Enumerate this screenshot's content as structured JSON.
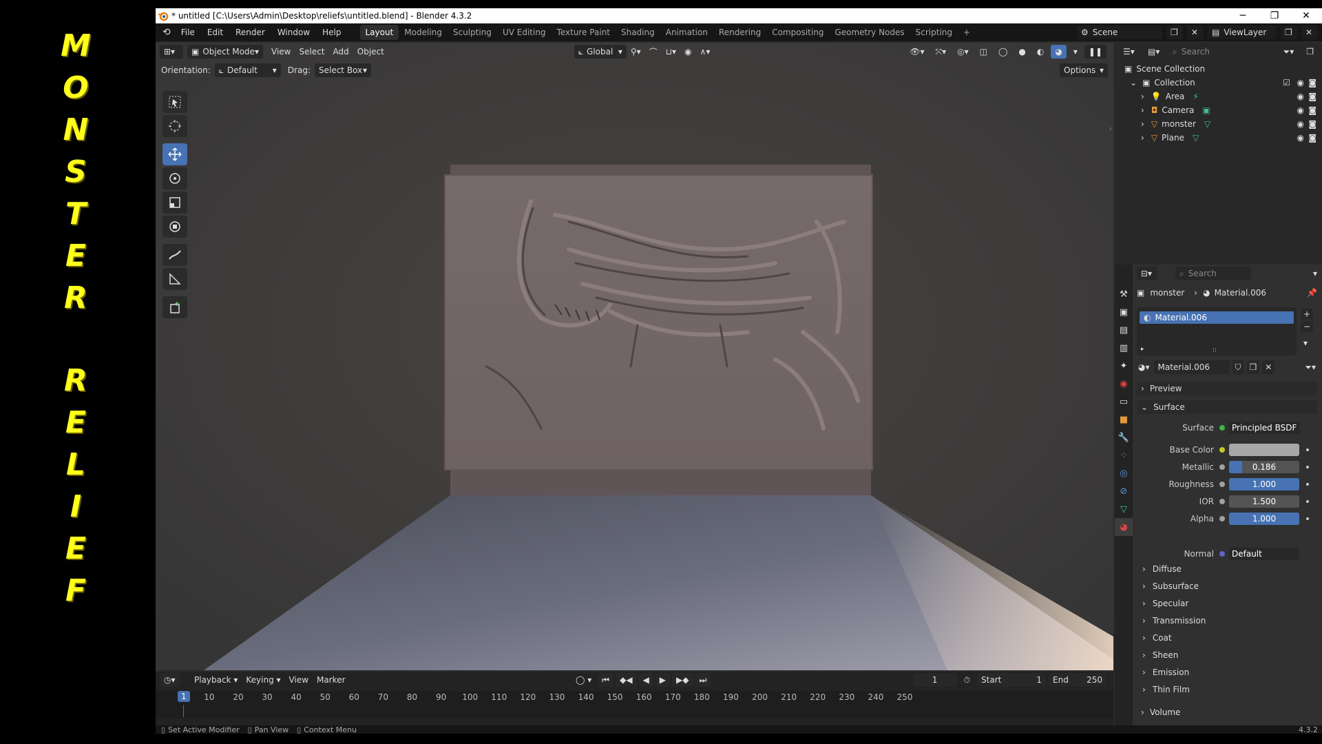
{
  "banner": {
    "word1": [
      "M",
      "O",
      "N",
      "S",
      "T",
      "E",
      "R"
    ],
    "word2": [
      "R",
      "E",
      "L",
      "I",
      "E",
      "F"
    ]
  },
  "titlebar": {
    "title": "* untitled [C:\\Users\\Admin\\Desktop\\reliefs\\untitled.blend] - Blender 4.3.2"
  },
  "menu": [
    "File",
    "Edit",
    "Render",
    "Window",
    "Help"
  ],
  "workspaces": [
    "Layout",
    "Modeling",
    "Sculpting",
    "UV Editing",
    "Texture Paint",
    "Shading",
    "Animation",
    "Rendering",
    "Compositing",
    "Geometry Nodes",
    "Scripting"
  ],
  "scene_label": "Scene",
  "viewlayer_label": "ViewLayer",
  "viewport": {
    "mode": "Object Mode",
    "menus": [
      "View",
      "Select",
      "Add",
      "Object"
    ],
    "transform": "Global",
    "search_placeholder": "Search",
    "orientation_label": "Orientation:",
    "orientation_value": "Default",
    "drag_label": "Drag:",
    "drag_value": "Select Box",
    "options_label": "Options"
  },
  "timeline": {
    "menus": [
      "Playback",
      "Keying",
      "View",
      "Marker"
    ],
    "current_frame": "1",
    "start_label": "Start",
    "start_value": "1",
    "end_label": "End",
    "end_value": "250",
    "ticks": [
      "1",
      "10",
      "20",
      "30",
      "40",
      "50",
      "60",
      "70",
      "80",
      "90",
      "100",
      "110",
      "120",
      "130",
      "140",
      "150",
      "160",
      "170",
      "180",
      "190",
      "200",
      "210",
      "220",
      "230",
      "240",
      "250"
    ]
  },
  "statusbar": {
    "items": [
      "Set Active Modifier",
      "Pan View",
      "Context Menu"
    ],
    "version": "4.3.2"
  },
  "outliner": {
    "search_placeholder": "Search",
    "root": "Scene Collection",
    "collection": "Collection",
    "items": [
      "Area",
      "Camera",
      "monster",
      "Plane"
    ]
  },
  "properties": {
    "search_placeholder": "Search",
    "breadcrumb_object": "monster",
    "breadcrumb_material": "Material.006",
    "slot_name": "Material.006",
    "material_name": "Material.006",
    "preview_label": "Preview",
    "surface_label": "Surface",
    "surface_field_label": "Surface",
    "surface_shader": "Principled BSDF",
    "rows": [
      {
        "label": "Base Color",
        "value": "",
        "fill": 0,
        "socket": "#c7c729"
      },
      {
        "label": "Metallic",
        "value": "0.186",
        "fill": 0.186,
        "socket": "#a1a1a1"
      },
      {
        "label": "Roughness",
        "value": "1.000",
        "fill": 1.0,
        "socket": "#a1a1a1"
      },
      {
        "label": "IOR",
        "value": "1.500",
        "fill": 0,
        "socket": "#a1a1a1"
      },
      {
        "label": "Alpha",
        "value": "1.000",
        "fill": 1.0,
        "socket": "#a1a1a1"
      }
    ],
    "normal_label": "Normal",
    "normal_value": "Default",
    "subpanels": [
      "Diffuse",
      "Subsurface",
      "Specular",
      "Transmission",
      "Coat",
      "Sheen",
      "Emission",
      "Thin Film"
    ],
    "volume_label": "Volume"
  },
  "colors": {
    "accent": "#4772b3",
    "banner_text": "#ffff1a",
    "base_color_swatch": "#a7a7a7"
  }
}
